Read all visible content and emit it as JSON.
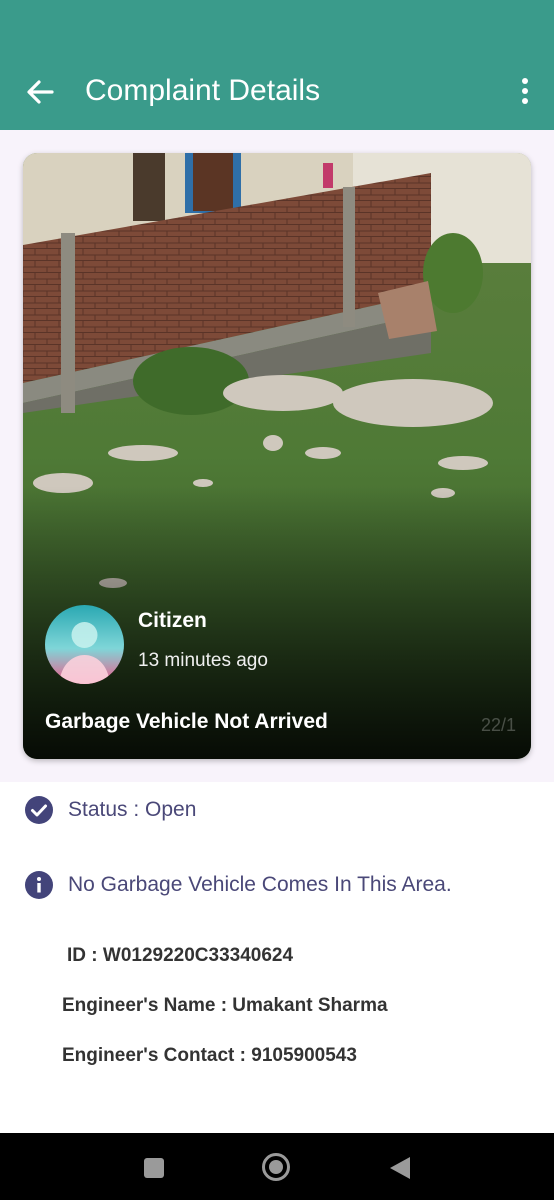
{
  "appbar": {
    "title": "Complaint Details",
    "back_icon": "arrow-back-icon",
    "menu_icon": "more-vert-icon",
    "color": "#3a9b8b"
  },
  "card": {
    "author": "Citizen",
    "time_ago": "13 minutes ago",
    "complaint_title": "Garbage Vehicle Not Arrived",
    "photo_stamp": "22/1"
  },
  "status": {
    "icon": "check-circle-icon",
    "text": "Status : Open"
  },
  "description": {
    "icon": "info-icon",
    "text": "No Garbage Vehicle Comes In This Area."
  },
  "details": {
    "id": "ID :  W0129220C33340624",
    "engineer_name": "Engineer's Name : Umakant Sharma",
    "engineer_contact": "Engineer's Contact : 9105900543"
  },
  "navbar": {
    "recents_icon": "square-icon",
    "home_icon": "home-circle-icon",
    "back_icon": "triangle-back-icon"
  }
}
